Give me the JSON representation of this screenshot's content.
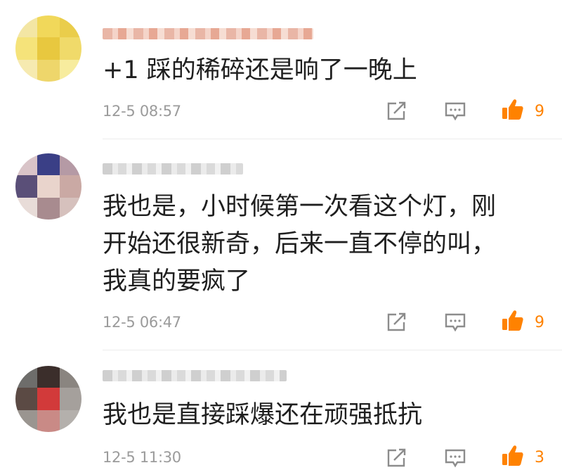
{
  "comments": [
    {
      "text": "+1 踩的稀碎还是响了一晚上",
      "time": "12-5 08:57",
      "likes": "9",
      "avatar_tones": [
        "#f3e6a4",
        "#f1d85a",
        "#eacd4b",
        "#f5e37a",
        "#e8c83f",
        "#f0da6a",
        "#f6eab0",
        "#eed66b",
        "#f7ec9e"
      ]
    },
    {
      "text": "我也是，小时候第一次看这个灯，刚\n开始还很新奇，后来一直不停的叫，\n我真的要疯了",
      "time": "12-5 06:47",
      "likes": "9",
      "avatar_tones": [
        "#d9c4c8",
        "#3a3f86",
        "#b59aa5",
        "#5a4f78",
        "#e9d4cc",
        "#caa9a4",
        "#e8dcd8",
        "#a88b8f",
        "#d6c1bd"
      ]
    },
    {
      "text": "我也是直接踩爆还在顽强抵抗",
      "time": "12-5 11:30",
      "likes": "3",
      "avatar_tones": [
        "#6e6d6b",
        "#3b2e2b",
        "#8a8580",
        "#5b4a44",
        "#d23a3a",
        "#a5a09c",
        "#9a9590",
        "#c98a86",
        "#b4b0ac"
      ]
    }
  ],
  "icons": {
    "repost": "share-square-icon",
    "comment": "comment-bubble-icon",
    "like": "thumbs-up-icon"
  },
  "colors": {
    "accent": "#ff8200",
    "text": "#1f1f1f",
    "meta": "#9b9b9b",
    "icon_gray": "#8c8c8c"
  }
}
